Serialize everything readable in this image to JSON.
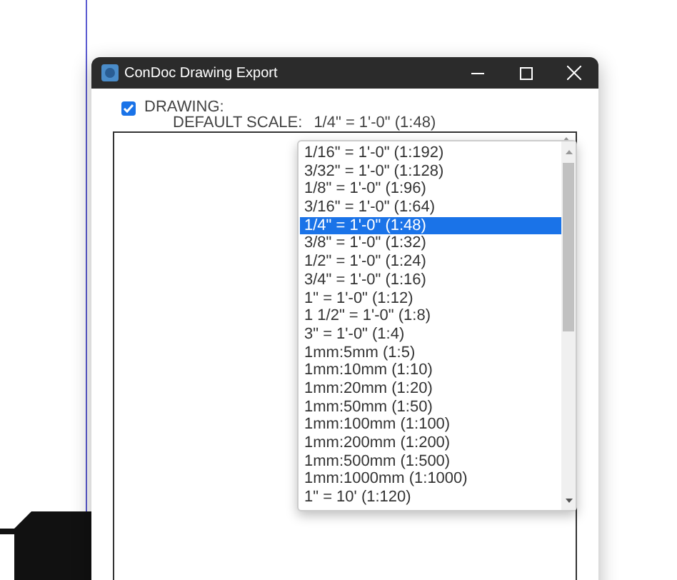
{
  "window": {
    "title": "ConDoc Drawing Export"
  },
  "drawing": {
    "label": "DRAWING:",
    "checked": true
  },
  "default_scale": {
    "label": "DEFAULT SCALE:",
    "value": "1/4\" = 1'-0\" (1:48)"
  },
  "options": [
    {
      "label": "1/16\" = 1'-0\" (1:192)",
      "selected": false
    },
    {
      "label": "3/32\" = 1'-0\" (1:128)",
      "selected": false
    },
    {
      "label": "1/8\" = 1'-0\" (1:96)",
      "selected": false
    },
    {
      "label": "3/16\" = 1'-0\" (1:64)",
      "selected": false
    },
    {
      "label": "1/4\" = 1'-0\" (1:48)",
      "selected": true
    },
    {
      "label": "3/8\" = 1'-0\" (1:32)",
      "selected": false
    },
    {
      "label": "1/2\" = 1'-0\" (1:24)",
      "selected": false
    },
    {
      "label": "3/4\" = 1'-0\" (1:16)",
      "selected": false
    },
    {
      "label": "1\" = 1'-0\" (1:12)",
      "selected": false
    },
    {
      "label": "1 1/2\" = 1'-0\" (1:8)",
      "selected": false
    },
    {
      "label": "3\" = 1'-0\" (1:4)",
      "selected": false
    },
    {
      "label": "1mm:5mm (1:5)",
      "selected": false
    },
    {
      "label": "1mm:10mm (1:10)",
      "selected": false
    },
    {
      "label": "1mm:20mm (1:20)",
      "selected": false
    },
    {
      "label": "1mm:50mm (1:50)",
      "selected": false
    },
    {
      "label": "1mm:100mm (1:100)",
      "selected": false
    },
    {
      "label": "1mm:200mm (1:200)",
      "selected": false
    },
    {
      "label": "1mm:500mm (1:500)",
      "selected": false
    },
    {
      "label": "1mm:1000mm (1:1000)",
      "selected": false
    },
    {
      "label": "1\" = 10' (1:120)",
      "selected": false
    }
  ]
}
